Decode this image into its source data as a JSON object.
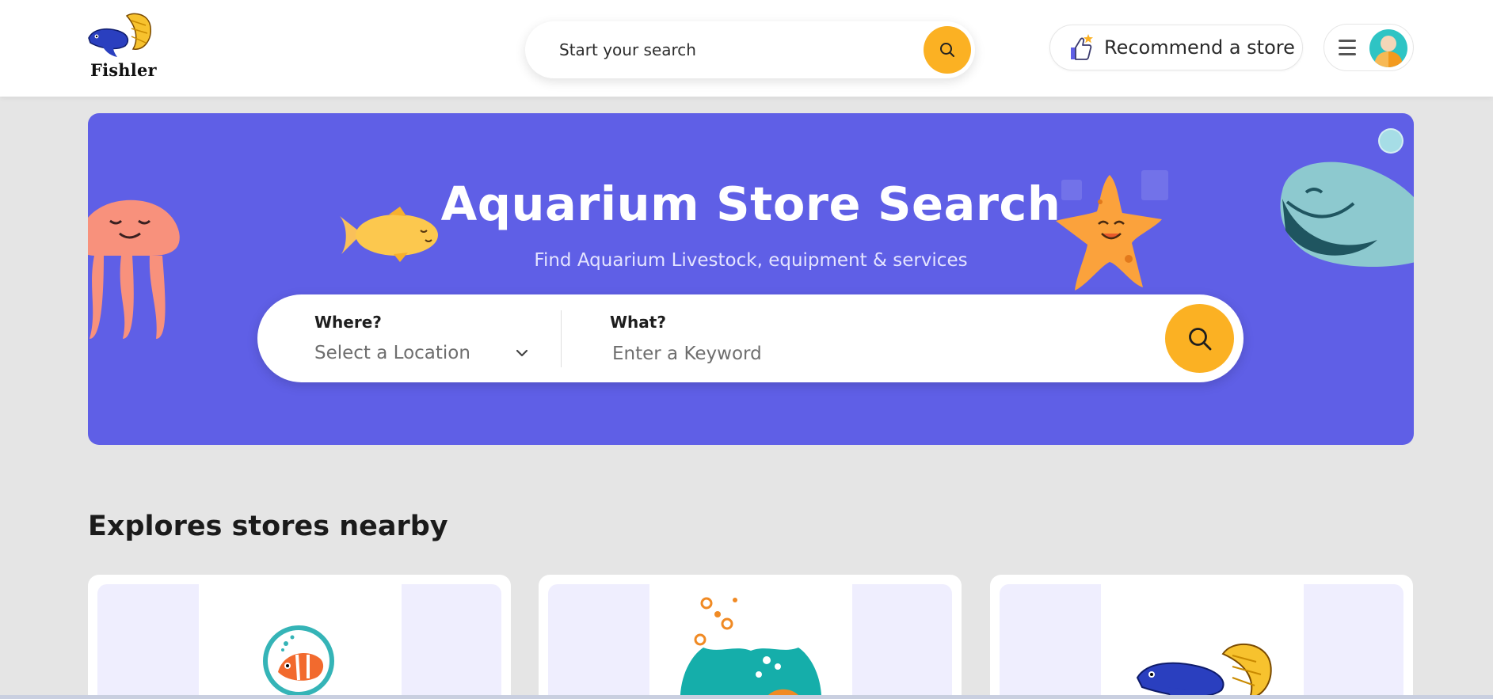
{
  "header": {
    "logo_text": "Fishler",
    "search_placeholder": "Start your search",
    "recommend_label": "Recommend a store",
    "icons": [
      "fish-logo",
      "search-icon",
      "thumbs-up-icon",
      "menu-icon",
      "avatar"
    ],
    "accent_color": "#fbb123"
  },
  "hero": {
    "title": "Aquarium Store Search",
    "subtitle": "Find Aquarium Livestock, equipment & services",
    "background_color": "#5f5fe6",
    "where_label": "Where?",
    "location_value": "Select a Location",
    "what_label": "What?",
    "keyword_placeholder": "Enter a Keyword"
  },
  "section": {
    "title": "Explores stores nearby"
  },
  "stores": [
    {
      "image_icon": "clownfish-logo"
    },
    {
      "image_icon": "fishbowl-logo"
    },
    {
      "image_icon": "betta-fish-logo"
    }
  ]
}
